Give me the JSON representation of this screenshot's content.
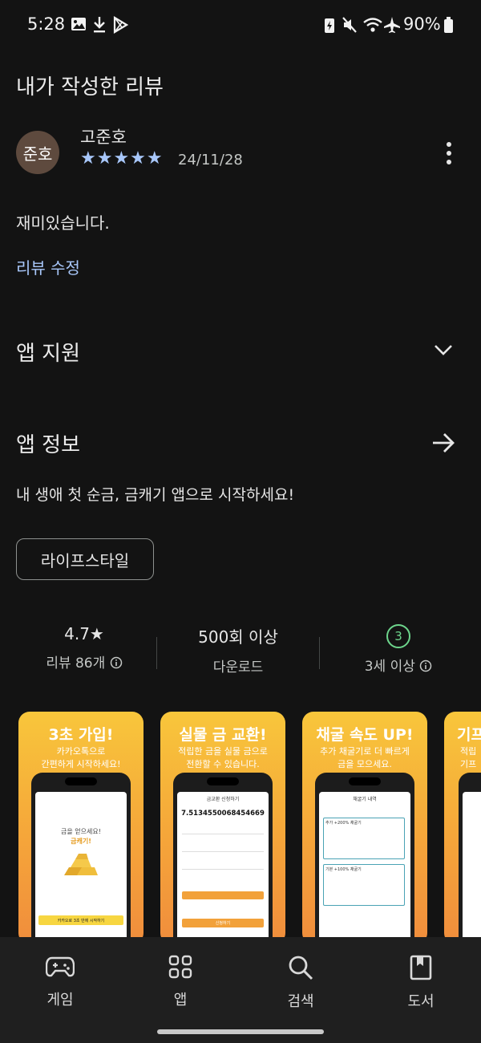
{
  "status": {
    "time": "5:28",
    "battery": "90%"
  },
  "my_review": {
    "heading": "내가 작성한 리뷰",
    "avatar_text": "준호",
    "author": "고준호",
    "stars": "★★★★★",
    "date": "24/11/28",
    "text": "재미있습니다.",
    "edit_label": "리뷰 수정"
  },
  "app_support": {
    "title": "앱 지원"
  },
  "app_info": {
    "title": "앱 정보",
    "description": "내 생애 첫 순금, 금캐기 앱으로 시작하세요!",
    "category_chip": "라이프스타일"
  },
  "stats": {
    "rating": "4.7★",
    "reviews": "리뷰 86개",
    "downloads": "500회 이상",
    "downloads_label": "다운로드",
    "age_badge": "3",
    "age_label": "3세 이상"
  },
  "screenshots": [
    {
      "title": "3초 가입!",
      "sub1": "카카오톡으로",
      "sub2": "간편하게 시작하세요!",
      "screen_line1": "금을 얻으세요!",
      "screen_line2": "금캐기!",
      "screen_button": "카카오로 3초 만에 시작하기"
    },
    {
      "title": "실물 금 교환!",
      "sub1": "적립한 금을 실물 금으로",
      "sub2": "전환할 수 있습니다.",
      "screen_header": "금교환 신청하기",
      "screen_value": "7.5134550068454669",
      "screen_button": "신청하기"
    },
    {
      "title": "채굴 속도 UP!",
      "sub1": "추가 채굴기로 더 빠르게",
      "sub2": "금을 모으세요.",
      "screen_header": "채굴기 내역",
      "box1": "추가 +200% 채굴기",
      "box2": "기본 +100% 채굴기"
    },
    {
      "title": "기프",
      "sub1": "적립",
      "sub2": "기프"
    }
  ],
  "bottom_nav": [
    {
      "label": "게임",
      "icon": "gamepad-icon"
    },
    {
      "label": "앱",
      "icon": "apps-grid-icon"
    },
    {
      "label": "검색",
      "icon": "search-icon"
    },
    {
      "label": "도서",
      "icon": "book-icon"
    }
  ],
  "colors": {
    "background": "#131313",
    "accent": "#a8c7fa",
    "age_badge": "#6dd58c"
  }
}
